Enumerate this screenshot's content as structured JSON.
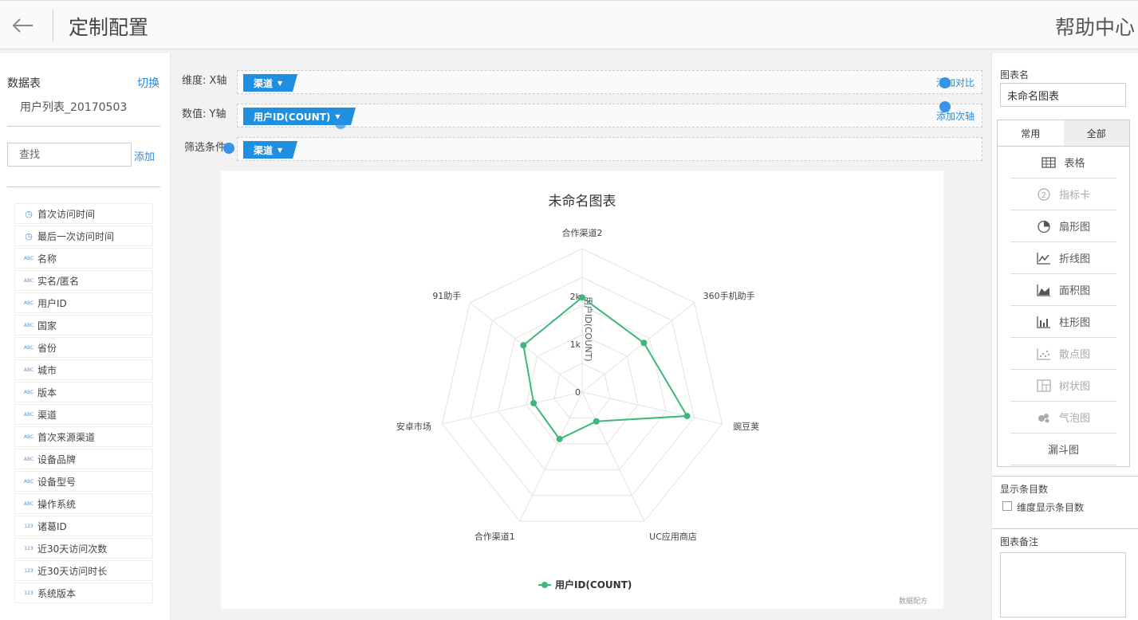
{
  "header": {
    "title": "定制配置",
    "help": "帮助中心"
  },
  "left": {
    "datasource_label": "数据表",
    "switch_label": "切换",
    "table_name": "用户列表_20170503",
    "search_placeholder": "查找",
    "add_label": "添加",
    "fields": [
      {
        "icon": "clock-icon",
        "type": "time",
        "label": "首次访问时间"
      },
      {
        "icon": "clock-icon",
        "type": "time",
        "label": "最后一次访问时间"
      },
      {
        "icon": "abc-icon",
        "type": "text",
        "label": "名称"
      },
      {
        "icon": "abc-icon",
        "type": "text",
        "label": "实名/匿名"
      },
      {
        "icon": "abc-icon",
        "type": "text",
        "label": "用户ID"
      },
      {
        "icon": "abc-icon",
        "type": "text",
        "label": "国家"
      },
      {
        "icon": "abc-icon",
        "type": "text",
        "label": "省份"
      },
      {
        "icon": "abc-icon",
        "type": "text",
        "label": "城市"
      },
      {
        "icon": "abc-icon",
        "type": "text",
        "label": "版本"
      },
      {
        "icon": "abc-icon",
        "type": "text",
        "label": "渠道"
      },
      {
        "icon": "abc-icon",
        "type": "text",
        "label": "首次来源渠道"
      },
      {
        "icon": "abc-icon",
        "type": "text",
        "label": "设备品牌"
      },
      {
        "icon": "abc-icon",
        "type": "text",
        "label": "设备型号"
      },
      {
        "icon": "abc-icon",
        "type": "text",
        "label": "操作系统"
      },
      {
        "icon": "123-icon",
        "type": "number",
        "label": "诸葛ID"
      },
      {
        "icon": "123-icon",
        "type": "number",
        "label": "近30天访问次数"
      },
      {
        "icon": "123-icon",
        "type": "number",
        "label": "近30天访问时长"
      },
      {
        "icon": "123-icon",
        "type": "number",
        "label": "系统版本"
      }
    ]
  },
  "config": {
    "dimension_label": "维度: X轴",
    "dimension_tag": "渠道",
    "add_compare": "添加对比",
    "value_label": "数值: Y轴",
    "value_tag": "用户ID(COUNT)",
    "add_secondary_axis": "添加次轴",
    "filter_label": "筛选条件",
    "filter_tag": "渠道"
  },
  "chart_data": {
    "type": "radar",
    "title": "未命名图表",
    "categories": [
      "合作渠道2",
      "360手机助手",
      "豌豆荚",
      "UC应用商店",
      "合作渠道1",
      "安卓市场",
      "91助手"
    ],
    "series": [
      {
        "name": "用户ID(COUNT)",
        "color": "#3cb878",
        "values": [
          1980,
          1650,
          2250,
          680,
          1090,
          1040,
          1570
        ]
      }
    ],
    "radial_axis": {
      "label": "用户ID(COUNT)",
      "ticks": [
        "0",
        "1k",
        "2k"
      ],
      "range": [
        0,
        3000
      ]
    },
    "legend_position": "bottom-center",
    "watermark": "数据配方"
  },
  "right": {
    "chart_name_label": "图表名",
    "chart_name_value": "未命名图表",
    "tabs": [
      "常用",
      "全部"
    ],
    "chart_types": [
      {
        "icon": "table-icon",
        "label": "表格",
        "enabled": true
      },
      {
        "icon": "indicator-card-icon",
        "label": "指标卡",
        "enabled": false
      },
      {
        "icon": "pie-chart-icon",
        "label": "扇形图",
        "enabled": true
      },
      {
        "icon": "line-chart-icon",
        "label": "折线图",
        "enabled": true
      },
      {
        "icon": "area-chart-icon",
        "label": "面积图",
        "enabled": true
      },
      {
        "icon": "bar-chart-icon",
        "label": "柱形图",
        "enabled": true
      },
      {
        "icon": "scatter-chart-icon",
        "label": "散点图",
        "enabled": false
      },
      {
        "icon": "treemap-icon",
        "label": "树状图",
        "enabled": false
      },
      {
        "icon": "bubble-chart-icon",
        "label": "气泡图",
        "enabled": false
      },
      {
        "icon": "",
        "label": "漏斗图",
        "enabled": true
      }
    ],
    "display_count_label": "显示条目数",
    "dimension_count_label": "维度显示条目数",
    "notes_label": "图表备注"
  }
}
